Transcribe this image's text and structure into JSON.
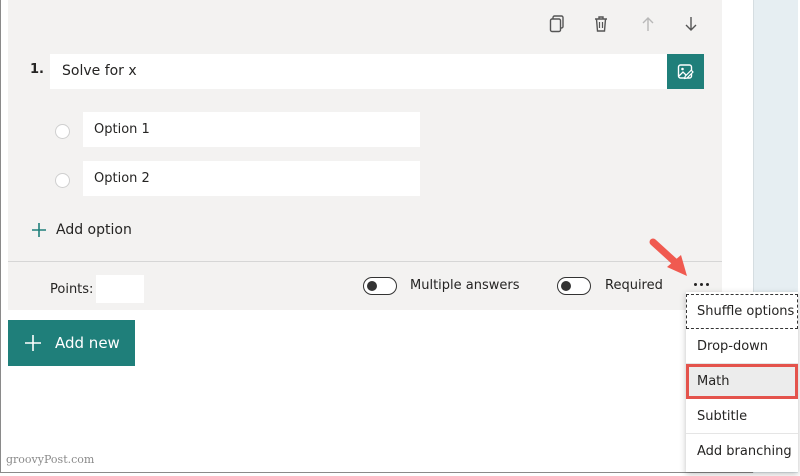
{
  "question": {
    "number": "1.",
    "title": "Solve for x",
    "options": [
      "Option 1",
      "Option 2"
    ],
    "add_option_label": "Add option"
  },
  "toolbar": {
    "icons": [
      "copy-icon",
      "delete-icon",
      "move-up-icon",
      "move-down-icon"
    ]
  },
  "footer": {
    "points_label": "Points:",
    "points_value": "",
    "multiple_answers_label": "Multiple answers",
    "required_label": "Required",
    "multiple_answers_on": false,
    "required_on": false
  },
  "add_new_label": "Add new",
  "more_menu": {
    "items": [
      "Shuffle options",
      "Drop-down",
      "Math",
      "Subtitle",
      "Add branching"
    ],
    "highlighted": "Math"
  },
  "watermark": "groovyPost.com",
  "colors": {
    "accent": "#1f7f7a",
    "highlight_border": "#e4534c",
    "arrow": "#f05a50",
    "card_bg": "#f3f2f1"
  }
}
